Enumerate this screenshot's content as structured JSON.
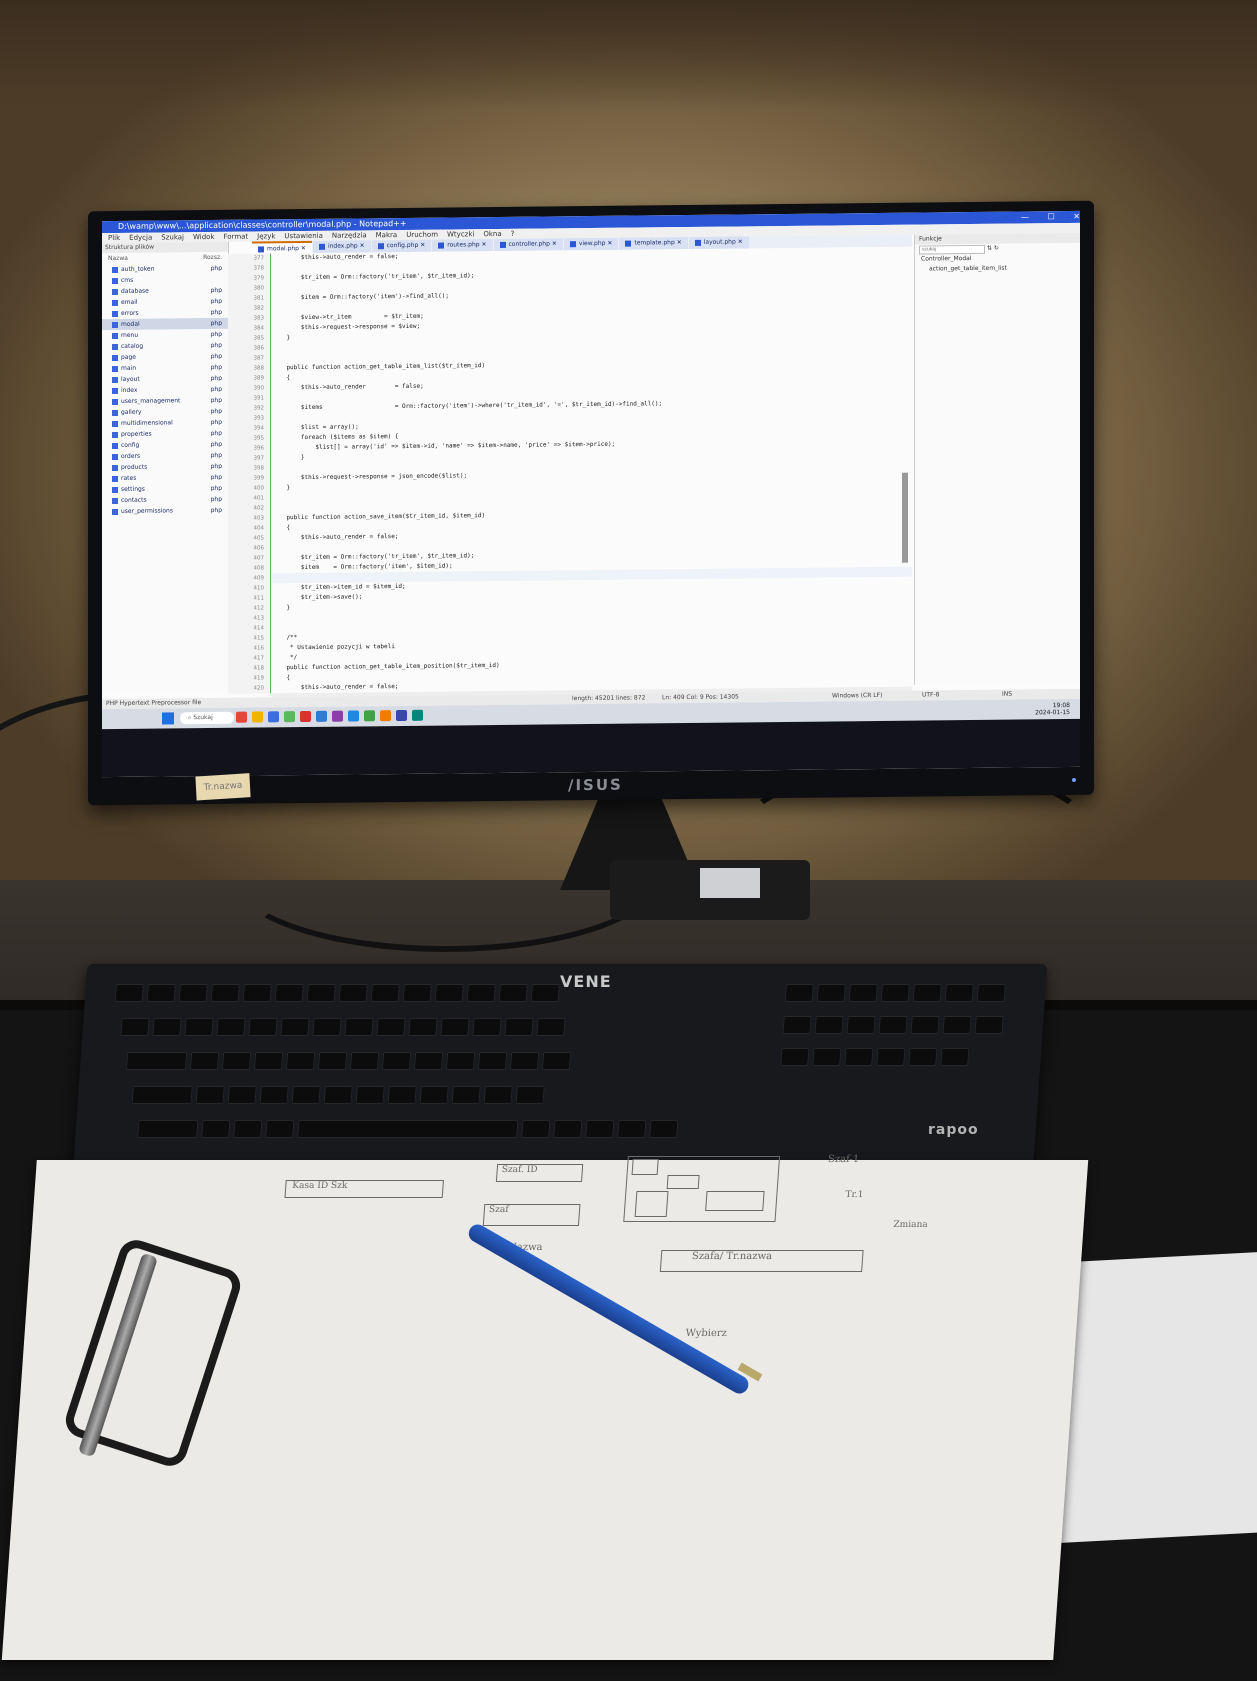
{
  "ide": {
    "title": "D:\\wamp\\www\\...\\application\\classes\\controller\\modal.php - Notepad++",
    "menu": [
      "Plik",
      "Edycja",
      "Szukaj",
      "Widok",
      "Format",
      "Język",
      "Ustawienia",
      "Narzędzia",
      "Makra",
      "Uruchom",
      "Wtyczki",
      "Okna",
      "?"
    ],
    "tabs": [
      "modal.php",
      "index.php",
      "config.php",
      "routes.php",
      "controller.php",
      "view.php",
      "template.php",
      "layout.php"
    ],
    "active_tab": "modal.php",
    "sidebar": {
      "header": "Struktura plików",
      "col_name": "Nazwa",
      "col_ext": "Rozsz.",
      "files": [
        {
          "name": "auth_token",
          "ext": "php"
        },
        {
          "name": "cms",
          "ext": ""
        },
        {
          "name": "database",
          "ext": "php"
        },
        {
          "name": "email",
          "ext": "php"
        },
        {
          "name": "errors",
          "ext": "php"
        },
        {
          "name": "modal",
          "ext": "php"
        },
        {
          "name": "menu",
          "ext": "php"
        },
        {
          "name": "catalog",
          "ext": "php"
        },
        {
          "name": "page",
          "ext": "php"
        },
        {
          "name": "main",
          "ext": "php"
        },
        {
          "name": "layout",
          "ext": "php"
        },
        {
          "name": "index",
          "ext": "php"
        },
        {
          "name": "users_management",
          "ext": "php"
        },
        {
          "name": "gallery",
          "ext": "php"
        },
        {
          "name": "multidimensional",
          "ext": "php"
        },
        {
          "name": "properties",
          "ext": "php"
        },
        {
          "name": "config",
          "ext": "php"
        },
        {
          "name": "orders",
          "ext": "php"
        },
        {
          "name": "products",
          "ext": "php"
        },
        {
          "name": "rates",
          "ext": "php"
        },
        {
          "name": "settings",
          "ext": "php"
        },
        {
          "name": "contacts",
          "ext": "php"
        },
        {
          "name": "user_permissions",
          "ext": "php"
        }
      ],
      "selected_index": 5
    },
    "line_numbers": [
      "377",
      "378",
      "379",
      "380",
      "381",
      "382",
      "383",
      "384",
      "385",
      "386",
      "387",
      "388",
      "389",
      "390",
      "391",
      "392",
      "393",
      "394",
      "395",
      "396",
      "397",
      "398",
      "399",
      "400",
      "401",
      "402",
      "403",
      "404",
      "405",
      "406",
      "407",
      "408",
      "409",
      "410",
      "411",
      "412",
      "413",
      "414",
      "415",
      "416",
      "417",
      "418",
      "419",
      "420"
    ],
    "code_lines": [
      "        $this->auto_render = false;",
      "",
      "        $tr_item = Orm::factory('tr_item', $tr_item_id);",
      "",
      "        $item = Orm::factory('item')->find_all();",
      "",
      "        $view->tr_item         = $tr_item;",
      "        $this->request->response = $view;",
      "    }",
      "",
      "",
      "    public function action_get_table_item_list($tr_item_id)",
      "    {",
      "        $this->auto_render        = false;",
      "",
      "        $items                    = Orm::factory('item')->where('tr_item_id', '=', $tr_item_id)->find_all();",
      "",
      "        $list = array();",
      "        foreach ($items as $item) {",
      "            $list[] = array('id' => $item->id, 'name' => $item->name, 'price' => $item->price);",
      "        }",
      "",
      "        $this->request->response = json_encode($list);",
      "    }",
      "",
      "",
      "    public function action_save_item($tr_item_id, $item_id)",
      "    {",
      "        $this->auto_render = false;",
      "",
      "        $tr_item = Orm::factory('tr_item', $tr_item_id);",
      "        $item    = Orm::factory('item', $item_id);",
      "",
      "        $tr_item->item_id = $item_id;",
      "        $tr_item->save();",
      "    }",
      "",
      "",
      "    /**",
      "     * Ustawienie pozycji w tabeli",
      "     */",
      "    public function action_get_table_item_position($tr_item_id)",
      "    {",
      "        $this->auto_render = false;"
    ],
    "highlight_line": 32,
    "right_panel": {
      "header": "Funkcje",
      "search_placeholder": "szukaj",
      "items": [
        "Controller_Modal",
        "action_get_table_item_list"
      ]
    },
    "status": {
      "left": "PHP Hypertext Preprocessor file",
      "mid": "length: 45201   lines: 872",
      "pos": "Ln: 409   Col: 9   Pos: 14305",
      "eol": "Windows (CR LF)",
      "enc": "UTF-8",
      "ins": "INS"
    },
    "taskbar": {
      "search": "Szukaj",
      "time": "19:08",
      "date": "2024-01-15",
      "icon_colors": [
        "#e8443a",
        "#f2b400",
        "#3b6ee0",
        "#5cb85c",
        "#d9332e",
        "#2e7bd3",
        "#8a3ea9",
        "#1e88e5",
        "#43a047",
        "#f57c00",
        "#3949ab",
        "#00897b"
      ]
    }
  },
  "hardware": {
    "monitor_brand": "/ISUS",
    "keyboard_logo": "VENE",
    "keyboard_brand": "rapoo"
  },
  "paper_sketch": {
    "box1": "Kasa  ID  Szk",
    "box2": "Szaf. ID",
    "label1": "Tr.  Nazwa",
    "label2": "Szafa/ Tr.nazwa",
    "label3": "Szaf",
    "label4": "Zmiana",
    "note1": "Szaf-1",
    "note2": "Tr.1",
    "label5": "Wybierz"
  },
  "sticky_note": "Tr.nazwa"
}
